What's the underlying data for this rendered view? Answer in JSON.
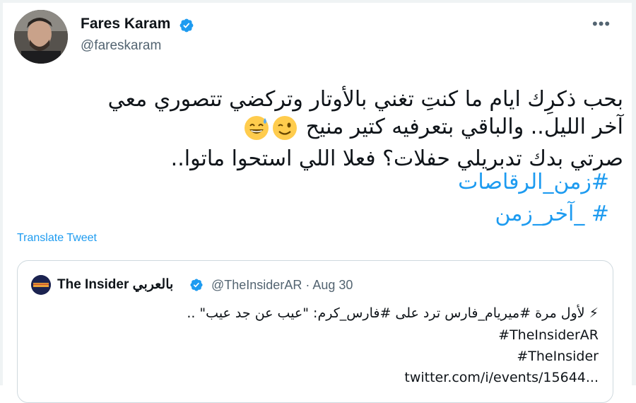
{
  "author": {
    "name": "Fares Karam",
    "handle": "@fareskaram"
  },
  "more_icon": "more-horizontal-icon",
  "tweet": {
    "line1": "بحب ذكرِك ايام ما كنتِ تغني بالأوتار وتركضي تتصوري معي",
    "line2": "آخر الليل.. والباقي بتعرفيه كتير منيح",
    "line3": "صرتي بدك تدبريلي حفلات؟ فعلا اللي استحوا ماتوا..",
    "emoji_1": "winking-face-icon",
    "emoji_2": "grinning-sweat-face-icon",
    "hashtag_1": "#زمن_الرقاصات",
    "hashtag_2": "#      _آخر_زمن"
  },
  "translate_label": "Translate Tweet",
  "quoted_tweet": {
    "name": "The Insider بالعربي",
    "handle": "@TheInsiderAR",
    "date": "Aug 30",
    "separator": "·",
    "line1": "⚡ لأول مرة #ميريام_فارس ترد على #فارس_كرم: \"عيب عن جد عيب\" ..",
    "line2": "#TheInsiderAR",
    "line3": "#TheInsider",
    "line4": "twitter.com/i/events/15644..."
  },
  "colors": {
    "link": "#1d9bf0",
    "verified": "#1d9bf0",
    "secondary_text": "#536471"
  }
}
